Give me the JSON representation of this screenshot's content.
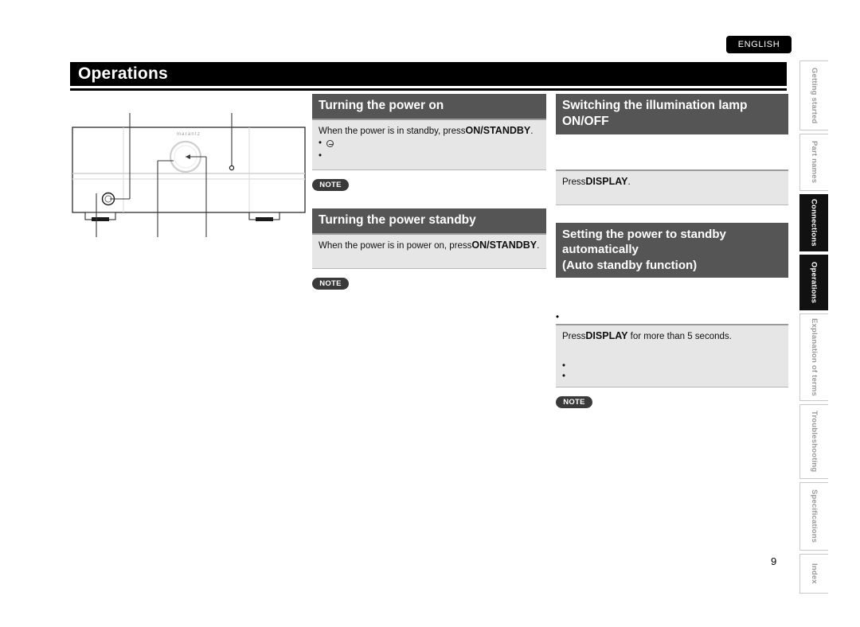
{
  "language_badge": "ENGLISH",
  "page_title": "Operations",
  "page_number": "9",
  "illustration": {
    "brand_logo": "marantz"
  },
  "middle_column": {
    "sections": [
      {
        "heading": "Turning the power on",
        "lead_prefix": "When the power is in standby, press",
        "lead_bold": "ON/STANDBY",
        "lead_suffix": ".",
        "bullets": [
          "",
          ""
        ],
        "note_label": "NOTE"
      },
      {
        "heading": "Turning the power standby",
        "lead_prefix": "When the power is in power on, press",
        "lead_bold": "ON/STANDBY",
        "lead_suffix": ".",
        "bullets": [],
        "note_label": "NOTE"
      }
    ]
  },
  "right_column": {
    "sections": [
      {
        "heading_line1": "Switching the illumination lamp",
        "heading_line2": "ON/OFF",
        "lead_prefix": "Press",
        "lead_bold": "DISPLAY",
        "lead_suffix": "."
      },
      {
        "heading_line1": "Setting the power to standby",
        "heading_line2": "automatically",
        "heading_line3": "(Auto standby function)",
        "pre_bullet": "",
        "lead_prefix": "Press",
        "lead_bold": "DISPLAY",
        "lead_suffix": " for more than 5 seconds.",
        "bullets": [
          "",
          ""
        ],
        "note_label": "NOTE"
      }
    ]
  },
  "side_tabs": [
    {
      "label": "Getting started",
      "active": false
    },
    {
      "label": "Part names",
      "active": false
    },
    {
      "label": "Connections",
      "active": true
    },
    {
      "label": "Operations",
      "active": true
    },
    {
      "label": "Explanation of terms",
      "active": false
    },
    {
      "label": "Troubleshooting",
      "active": false
    },
    {
      "label": "Specifications",
      "active": false
    },
    {
      "label": "Index",
      "active": false
    }
  ],
  "colors": {
    "title_bar": "#000000",
    "section_header": "#555555",
    "section_body": "#e6e6e6",
    "note_badge": "#3a3a3a",
    "active_tab": "#111111",
    "inactive_tab_text": "#9b9b9b"
  }
}
